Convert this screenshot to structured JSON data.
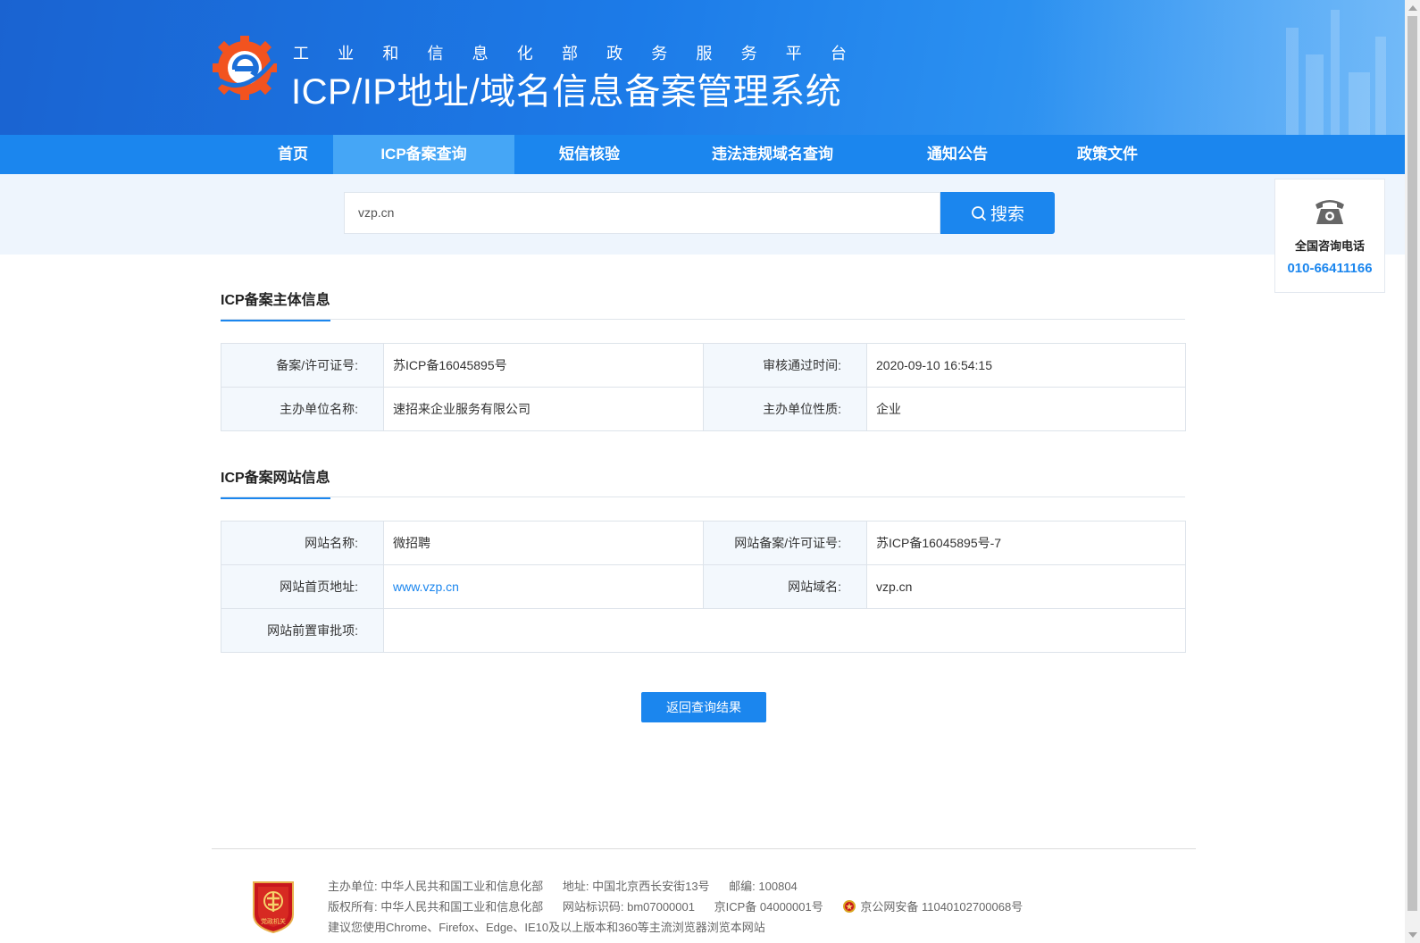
{
  "header": {
    "subtitle_chars": [
      "工",
      "业",
      "和",
      "信",
      "息",
      "化",
      "部",
      "政",
      "务",
      "服",
      "务",
      "平",
      "台"
    ],
    "title": "ICP/IP地址/域名信息备案管理系统",
    "logo_icon": "miit-logo-icon"
  },
  "nav": {
    "items": [
      {
        "label": "首页"
      },
      {
        "label": "ICP备案查询"
      },
      {
        "label": "短信核验"
      },
      {
        "label": "违法违规域名查询"
      },
      {
        "label": "通知公告"
      },
      {
        "label": "政策文件"
      }
    ],
    "active": "ICP备案查询"
  },
  "search": {
    "value": "vzp.cn",
    "button_label": "搜索"
  },
  "phone": {
    "label": "全国咨询电话",
    "number": "010-66411166"
  },
  "subject": {
    "title": "ICP备案主体信息",
    "rows": [
      {
        "k1": "备案/许可证号:",
        "v1": "苏ICP备16045895号",
        "k2": "审核通过时间:",
        "v2": "2020-09-10 16:54:15"
      },
      {
        "k1": "主办单位名称:",
        "v1": "速招来企业服务有限公司",
        "k2": "主办单位性质:",
        "v2": "企业"
      }
    ]
  },
  "website": {
    "title": "ICP备案网站信息",
    "name_label": "网站名称:",
    "name": "微招聘",
    "license_label": "网站备案/许可证号:",
    "license": "苏ICP备16045895号-7",
    "home_label": "网站首页地址:",
    "home": "www.vzp.cn",
    "domain_label": "网站域名:",
    "domain": "vzp.cn",
    "approval_label": "网站前置审批项:",
    "approval": ""
  },
  "back_button": "返回查询结果",
  "footer": {
    "host": "主办单位: 中华人民共和国工业和信息化部",
    "address": "地址: 中国北京西长安街13号",
    "postcode": "邮编: 100804",
    "copyright": "版权所有: 中华人民共和国工业和信息化部",
    "site_id": "网站标识码: bm07000001",
    "icp": "京ICP备 04000001号",
    "police": "京公网安备 11040102700068号",
    "browser_tip": "建议您使用Chrome、Firefox、Edge、IE10及以上版本和360等主流浏览器浏览本网站",
    "emblem_text": "党政机关"
  },
  "colors": {
    "primary": "#1b86ee",
    "nav_active": "#45a6f6",
    "banner": "#1c7be8"
  }
}
